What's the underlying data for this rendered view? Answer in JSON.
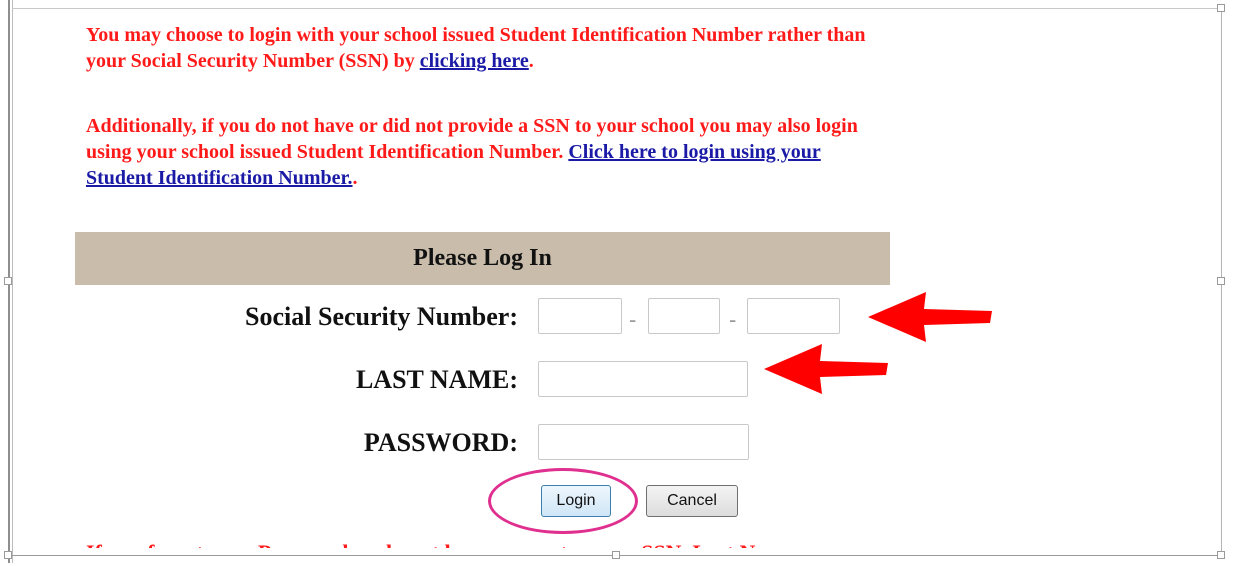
{
  "notice": {
    "para1_text": "You may choose to login with your school issued Student Identification Number rather than your Social Security Number (SSN) by ",
    "para1_link": "clicking here",
    "para1_end": ".",
    "para2_text": "Additionally, if you do not have or did not provide a SSN to your school you may also login using your school issued Student Identification Number. ",
    "para2_link": "Click here to login using your Student Identification Number.",
    "para2_end": "."
  },
  "login": {
    "header": "Please Log In",
    "ssn_label": "Social Security Number:",
    "ssn_sep": "-",
    "last_name_label": "LAST NAME:",
    "password_label": "PASSWORD:",
    "login_button": "Login",
    "cancel_button": "Cancel"
  },
  "footer": {
    "text": "If you forget your Password or do not have one, enter your SSN, Last Name"
  },
  "colors": {
    "notice_red": "#ff1a1a",
    "link_blue": "#1a1aa6",
    "header_bg": "#c9bcaa",
    "arrow_red": "#ff0000",
    "highlight_pink": "#e0308f"
  },
  "icons": [
    "red-arrow-icon",
    "red-arrow-icon"
  ]
}
